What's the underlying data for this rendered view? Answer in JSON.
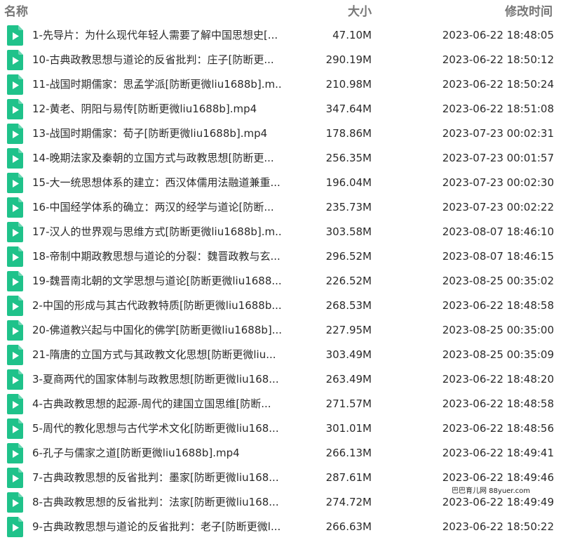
{
  "header": {
    "name_label": "名称",
    "size_label": "大小",
    "time_label": "修改时间"
  },
  "icon": {
    "name": "video-file-icon",
    "color": "#1fc28a"
  },
  "files": [
    {
      "name": "1-先导片：为什么现代年轻人需要了解中国思想史[...",
      "size": "47.10M",
      "time": "2023-06-22 18:48:05"
    },
    {
      "name": "10-古典政教思想与道论的反省批判：庄子[防断更...",
      "size": "290.19M",
      "time": "2023-06-22 18:50:12"
    },
    {
      "name": "11-战国时期儒家：思孟学派[防断更微liu1688b].m...",
      "size": "210.98M",
      "time": "2023-06-22 18:50:24"
    },
    {
      "name": "12-黄老、阴阳与易传[防断更微liu1688b].mp4",
      "size": "347.64M",
      "time": "2023-06-22 18:51:08"
    },
    {
      "name": "13-战国时期儒家：荀子[防断更微liu1688b].mp4",
      "size": "178.86M",
      "time": "2023-07-23 00:02:31"
    },
    {
      "name": "14-晚期法家及秦朝的立国方式与政教思想[防断更...",
      "size": "256.35M",
      "time": "2023-07-23 00:01:57"
    },
    {
      "name": "15-大一统思想体系的建立：西汉体儒用法融道兼重...",
      "size": "196.04M",
      "time": "2023-07-23 00:02:30"
    },
    {
      "name": "16-中国经学体系的确立：两汉的经学与道论[防断...",
      "size": "235.73M",
      "time": "2023-07-23 00:02:22"
    },
    {
      "name": "17-汉人的世界观与思维方式[防断更微liu1688b].m...",
      "size": "303.58M",
      "time": "2023-08-07 18:46:10"
    },
    {
      "name": "18-帝制中期政教思想与道论的分裂：魏晋政教与玄...",
      "size": "296.52M",
      "time": "2023-08-07 18:46:15"
    },
    {
      "name": "19-魏晋南北朝的文学思想与道论[防断更微liu1688...",
      "size": "226.52M",
      "time": "2023-08-25 00:35:02"
    },
    {
      "name": "2-中国的形成与其古代政教特质[防断更微liu1688b...",
      "size": "268.53M",
      "time": "2023-06-22 18:48:58"
    },
    {
      "name": "20-佛道教兴起与中国化的佛学[防断更微liu1688b]....",
      "size": "227.95M",
      "time": "2023-08-25 00:35:00"
    },
    {
      "name": "21-隋唐的立国方式与其政教文化思想[防断更微liu...",
      "size": "303.49M",
      "time": "2023-08-25 00:35:09"
    },
    {
      "name": "3-夏商两代的国家体制与政教思想[防断更微liu168...",
      "size": "263.49M",
      "time": "2023-06-22 18:48:20"
    },
    {
      "name": "4-古典政教思想的起源-周代的建国立国思维[防断...",
      "size": "271.57M",
      "time": "2023-06-22 18:48:58"
    },
    {
      "name": "5-周代的教化思想与古代学术文化[防断更微liu168...",
      "size": "301.01M",
      "time": "2023-06-22 18:48:56"
    },
    {
      "name": "6-孔子与儒家之道[防断更微liu1688b].mp4",
      "size": "266.13M",
      "time": "2023-06-22 18:49:41"
    },
    {
      "name": "7-古典政教思想的反省批判：墨家[防断更微liu168...",
      "size": "287.61M",
      "time": "2023-06-22 18:49:46"
    },
    {
      "name": "8-古典政教思想的反省批判：法家[防断更微liu168...",
      "size": "274.72M",
      "time": "2023-06-22 18:49:49"
    },
    {
      "name": "9-古典政教思想与道论的反省批判：老子[防断更微l...",
      "size": "266.63M",
      "time": "2023-06-22 18:50:22"
    }
  ],
  "watermark": "巴巴育儿网 88yuer.com"
}
